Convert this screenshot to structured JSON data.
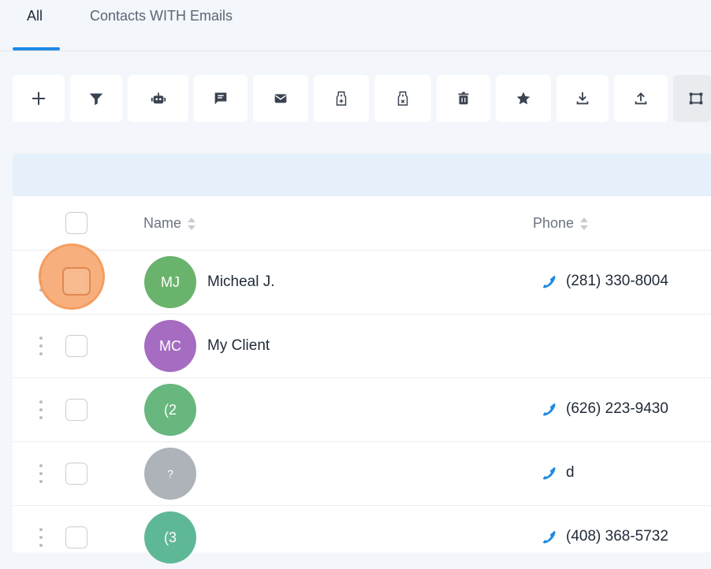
{
  "tabs": [
    {
      "label": "All",
      "active": true
    },
    {
      "label": "Contacts WITH Emails",
      "active": false
    }
  ],
  "toolbar": {
    "buttons": [
      {
        "icon": "plus-icon",
        "label": "add"
      },
      {
        "icon": "filter-icon",
        "label": "filter"
      },
      {
        "icon": "robot-icon",
        "label": "automation"
      },
      {
        "icon": "message-icon",
        "label": "sms"
      },
      {
        "icon": "mail-icon",
        "label": "email"
      },
      {
        "icon": "tag-add-icon",
        "label": "add-tag"
      },
      {
        "icon": "tag-remove-icon",
        "label": "remove-tag"
      },
      {
        "icon": "trash-icon",
        "label": "delete"
      },
      {
        "icon": "star-icon",
        "label": "favorite"
      },
      {
        "icon": "download-icon",
        "label": "export"
      },
      {
        "icon": "upload-icon",
        "label": "import"
      },
      {
        "icon": "merge-icon",
        "label": "merge"
      }
    ]
  },
  "table": {
    "headers": {
      "name": "Name",
      "phone": "Phone"
    },
    "rows": [
      {
        "initials": "MJ",
        "name": "Micheal J.",
        "phone": "(281) 330-8004",
        "avatar_color": "#6ab36c"
      },
      {
        "initials": "MC",
        "name": "My Client",
        "phone": "",
        "avatar_color": "#a56cc1"
      },
      {
        "initials": "(2",
        "name": "",
        "phone": "(626) 223-9430",
        "avatar_color": "#68b77e"
      },
      {
        "initials": "?",
        "name": "",
        "phone": "d",
        "avatar_color": "#aeb3ba"
      },
      {
        "initials": "(3",
        "name": "",
        "phone": "(408) 368-5732",
        "avatar_color": "#5fb895"
      }
    ]
  },
  "colors": {
    "accent": "#1e88e5",
    "phone_icon": "#1e88e5",
    "highlight": "#f7a870"
  }
}
